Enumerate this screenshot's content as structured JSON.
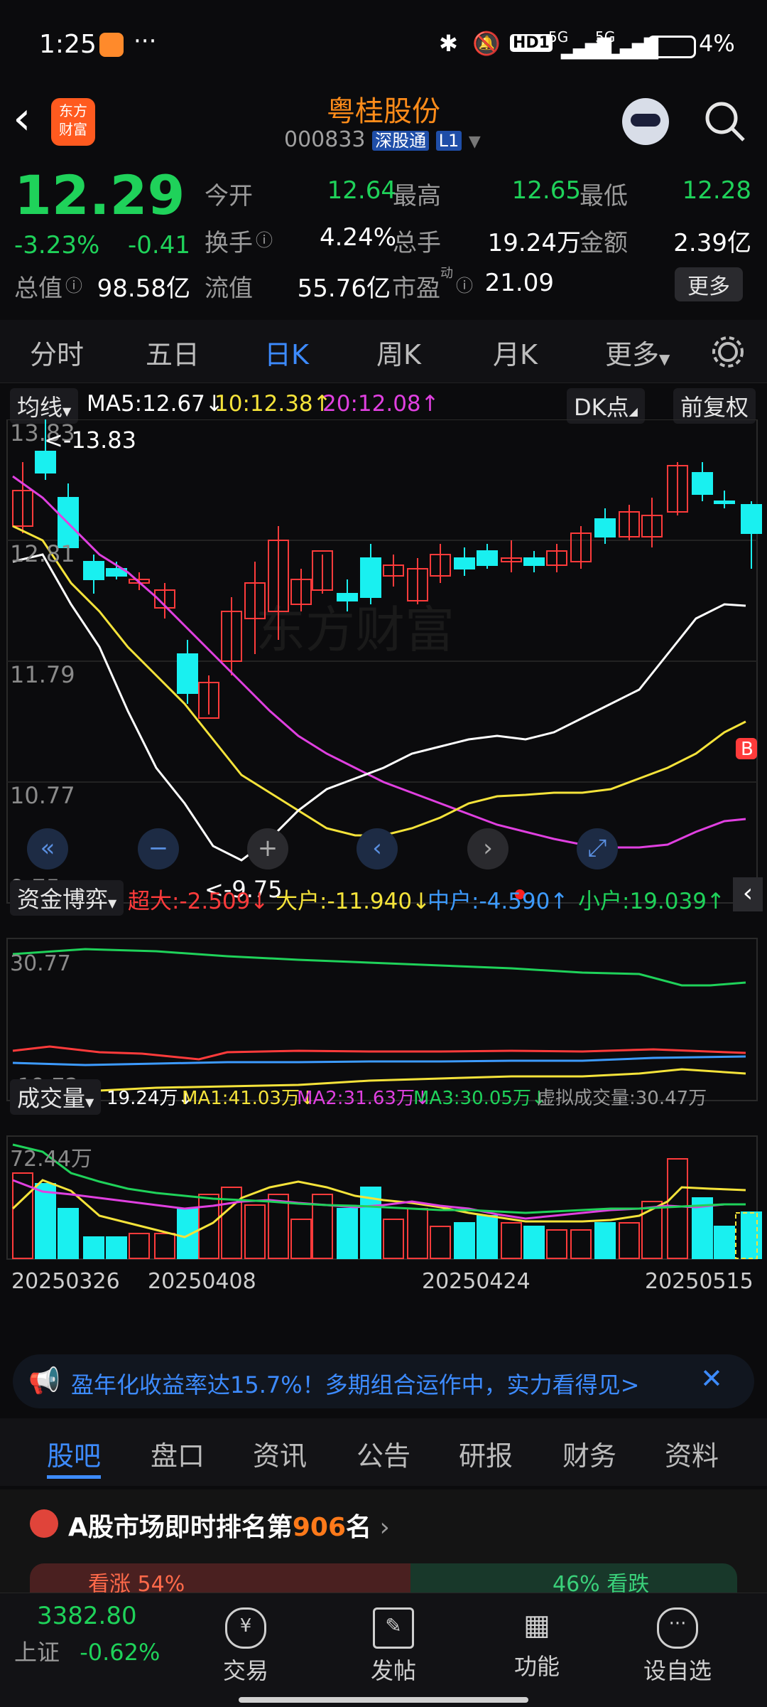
{
  "status_bar": {
    "time": "1:25",
    "dots": "···",
    "network_badge": "HD1",
    "sig1": "5G",
    "sig2": "5G",
    "battery": "4%"
  },
  "header": {
    "logo_line1": "东方",
    "logo_line2": "财富",
    "title": "粤桂股份",
    "code": "000833",
    "tag1": "深股通",
    "tag2": "L1"
  },
  "quote": {
    "price": "12.29",
    "pct": "-3.23%",
    "chg": "-0.41",
    "rows": [
      [
        {
          "k": "今开",
          "v": "12.64",
          "c": "green"
        },
        {
          "k": "最高",
          "v": "12.65",
          "c": "green"
        },
        {
          "k": "最低",
          "v": "12.28",
          "c": "green"
        }
      ],
      [
        {
          "k": "换手",
          "v": "4.24%",
          "c": "white"
        },
        {
          "k": "总手",
          "v": "19.24万",
          "c": "white"
        },
        {
          "k": "金额",
          "v": "2.39亿",
          "c": "white"
        }
      ],
      [
        {
          "k": "总值",
          "v": "98.58亿",
          "c": "white"
        },
        {
          "k": "流值",
          "v": "55.76亿",
          "c": "white"
        },
        {
          "k": "市盈",
          "v": "21.09",
          "c": "white"
        }
      ]
    ],
    "pe_sup": "动",
    "more": "更多"
  },
  "tabs": [
    "分时",
    "五日",
    "日K",
    "周K",
    "月K",
    "更多"
  ],
  "active_tab": "日K",
  "ma_legend": {
    "selector": "均线",
    "ma5": "MA5:12.67↓",
    "ma10": "10:12.38↑",
    "ma20": "20:12.08↑",
    "dk": "DK点",
    "adjust": "前复权"
  },
  "price_axis": [
    "13.83",
    "12.81",
    "11.79",
    "10.77",
    "9.75"
  ],
  "high_marker": "<-13.83",
  "low_marker": "<-9.75",
  "b_marker": "B",
  "capital": {
    "selector": "资金博弈",
    "super": "超大:-2.509↓",
    "big": "大户:-11.940↓",
    "mid": "中户:-4.590↑",
    "small": "小户:19.039↑",
    "top": "30.77",
    "bottom": "-19.72"
  },
  "volume": {
    "selector": "成交量",
    "vol": "19.24万↓",
    "ma1": "MA1:41.03万↓",
    "ma2": "MA2:31.63万↓",
    "ma3": "MA3:30.05万↓",
    "virtual": "虚拟成交量:30.47万",
    "top": "72.44万"
  },
  "dates": [
    "20250326",
    "20250408",
    "20250424",
    "20250515"
  ],
  "banner": "盈年化收益率达15.7%！多期组合运作中，实力看得见>",
  "subtabs": [
    "股吧",
    "盘口",
    "资讯",
    "公告",
    "研报",
    "财务",
    "资料"
  ],
  "rank": {
    "prefix": "A股市场即时排名第",
    "num": "906",
    "suffix": "名",
    "up_label": "看涨 54%",
    "down_label": "46% 看跌"
  },
  "bottom_bar": {
    "index_value": "3382.80",
    "index_name": "上证",
    "index_pct": "-0.62%",
    "items": [
      "交易",
      "发帖",
      "功能",
      "设自选"
    ]
  },
  "colors": {
    "up": "#ff3b3b",
    "down": "#1fd25a",
    "accent": "#3d8bff",
    "cyan": "#19f0f0"
  }
}
